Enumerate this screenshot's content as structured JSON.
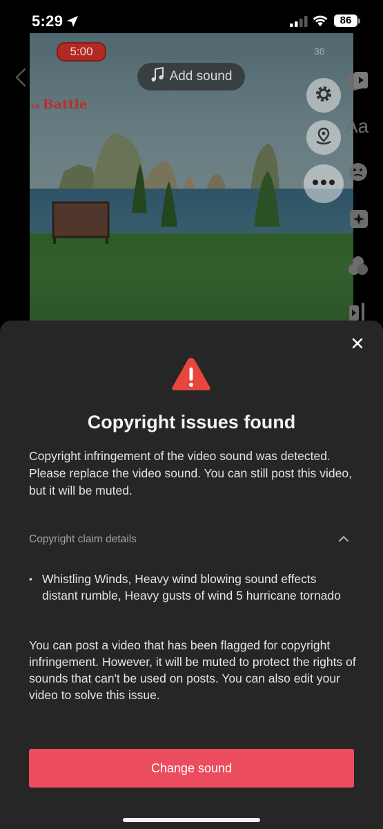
{
  "status_bar": {
    "time": "5:29",
    "battery_level": "86",
    "icons": [
      "location-arrow-icon",
      "signal-icon",
      "wifi-icon",
      "battery-icon"
    ]
  },
  "video": {
    "timer": "5:00",
    "score": "36",
    "logo_text": "Battle",
    "logo_vs": "vs"
  },
  "add_sound": {
    "label": "Add sound",
    "icon": "music-note-icon"
  },
  "side_buttons": [
    "settings-icon",
    "location-pin-icon",
    "more-icon"
  ],
  "right_tools": {
    "text_label": "Aa",
    "icons": [
      "video-templates-icon",
      "text-icon",
      "stickers-icon",
      "effects-icon",
      "filters-icon",
      "voice-icon"
    ]
  },
  "dialog": {
    "title": "Copyright issues found",
    "description": "Copyright infringement of the video sound was detected. Please replace the video sound. You can still post this video, but it will be muted.",
    "claim_details_label": "Copyright claim details",
    "claim_items": [
      "Whistling Winds, Heavy wind blowing sound effects distant rumble, Heavy gusts of wind 5 hurricane tornado"
    ],
    "note": "You can post a video that has been flagged for copyright infringement. However, it will be muted to protect the rights of sounds that can't be used on posts. You can also edit your video to solve this issue.",
    "change_sound_label": "Change sound"
  },
  "colors": {
    "sheet_bg": "#262626",
    "primary_button": "#ec4d5e",
    "warning_icon": "#e8463c"
  }
}
